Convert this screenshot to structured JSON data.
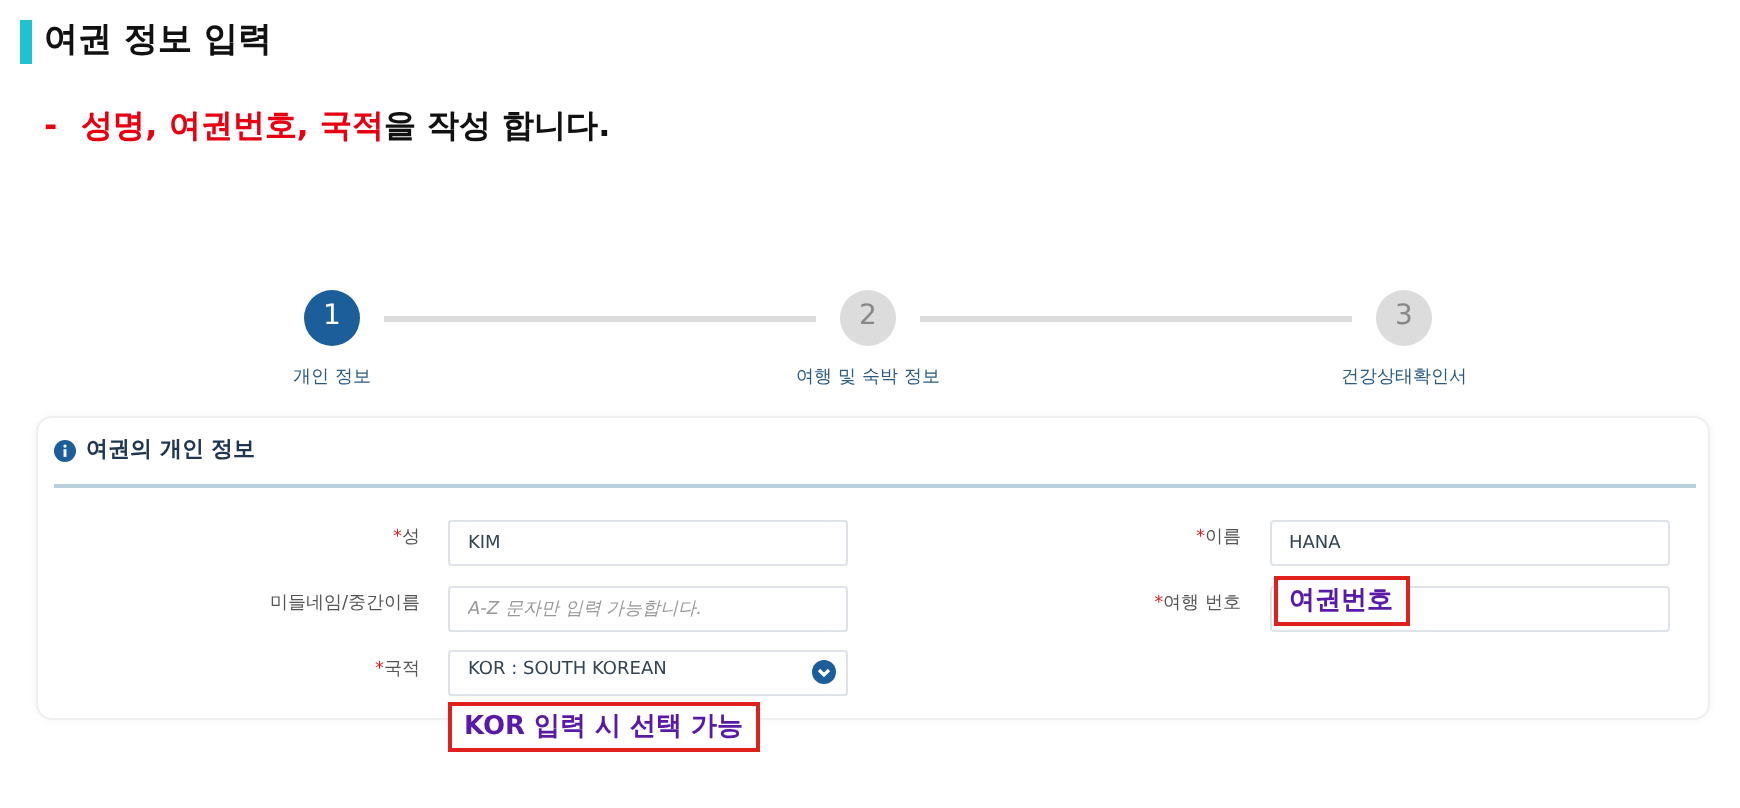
{
  "heading": "여권 정보 입력",
  "instruction": {
    "bullet": "-",
    "segments": [
      {
        "text": "성명, 여권번호, 국적",
        "highlight": true
      },
      {
        "text": "을 작성 합니다.",
        "highlight": false
      }
    ]
  },
  "steps": [
    {
      "number": "1",
      "label": "개인 정보",
      "selected": true
    },
    {
      "number": "2",
      "label": "여행 및 숙박 정보",
      "selected": false
    },
    {
      "number": "3",
      "label": "건강상태확인서",
      "selected": false
    }
  ],
  "section": {
    "title": "여권의 개인 정보"
  },
  "columns": [
    {
      "fields": [
        {
          "kind": "text",
          "required_mark": "*",
          "label": "성",
          "value": "KIM"
        },
        {
          "kind": "text",
          "label": "미들네임/중간이름",
          "placeholder": "A-Z 문자만 입력 가능합니다."
        },
        {
          "kind": "select",
          "required_mark": "*",
          "label": "국적",
          "value": "KOR : SOUTH KOREAN",
          "callout": "KOR 입력 시 선택 가능"
        }
      ]
    },
    {
      "fields": [
        {
          "kind": "text",
          "required_mark": "*",
          "label": "이름",
          "value": "HANA"
        },
        {
          "kind": "text",
          "required_mark": "*",
          "label": "여행 번호",
          "callout": "여권번호"
        }
      ]
    }
  ]
}
